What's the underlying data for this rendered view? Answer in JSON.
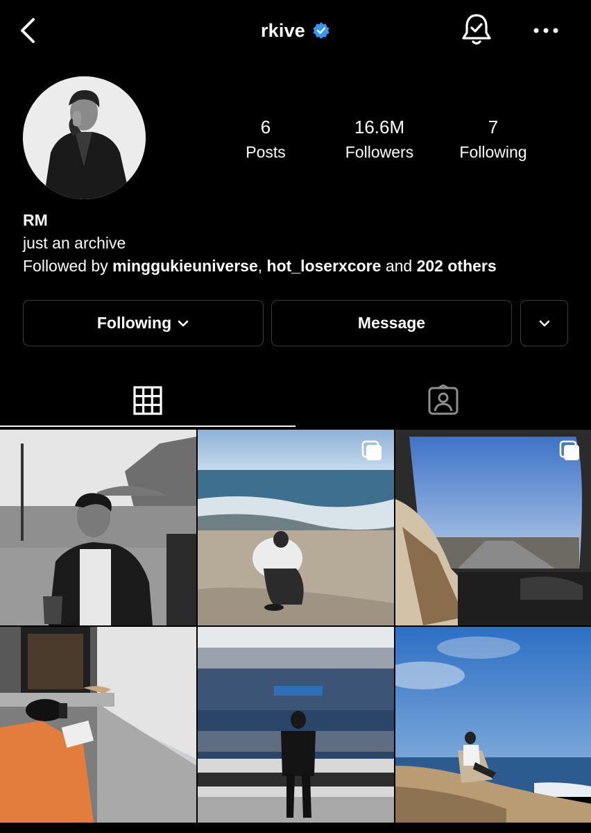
{
  "header": {
    "username": "rkive",
    "back_icon": "chevron-left-icon",
    "verified_icon": "verified-badge-icon",
    "bell_icon": "bell-check-icon",
    "more_icon": "ellipsis-icon",
    "verified_color": "#3897f0"
  },
  "profile": {
    "stats": {
      "posts_count": "6",
      "posts_label": "Posts",
      "followers_count": "16.6M",
      "followers_label": "Followers",
      "following_count": "7",
      "following_label": "Following"
    },
    "name": "RM",
    "bio": "just an archive",
    "followed_by": {
      "prefix": "Followed by ",
      "user1": "minggukieuniverse",
      "separator": ", ",
      "user2": "hot_loserxcore",
      "middle": " and ",
      "others": "202 others"
    }
  },
  "actions": {
    "following_label": "Following",
    "message_label": "Message"
  },
  "tabs": {
    "grid_icon": "grid-icon",
    "tagged_icon": "tagged-person-icon",
    "active": "grid"
  },
  "posts": [
    {
      "description": "bw-cafe-portrait",
      "multi": false
    },
    {
      "description": "beach-crouch",
      "multi": true
    },
    {
      "description": "car-window-road",
      "multi": true
    },
    {
      "description": "stairs-phone-photo",
      "multi": false
    },
    {
      "description": "stadium",
      "multi": false
    },
    {
      "description": "coastal-chair",
      "multi": false
    }
  ]
}
